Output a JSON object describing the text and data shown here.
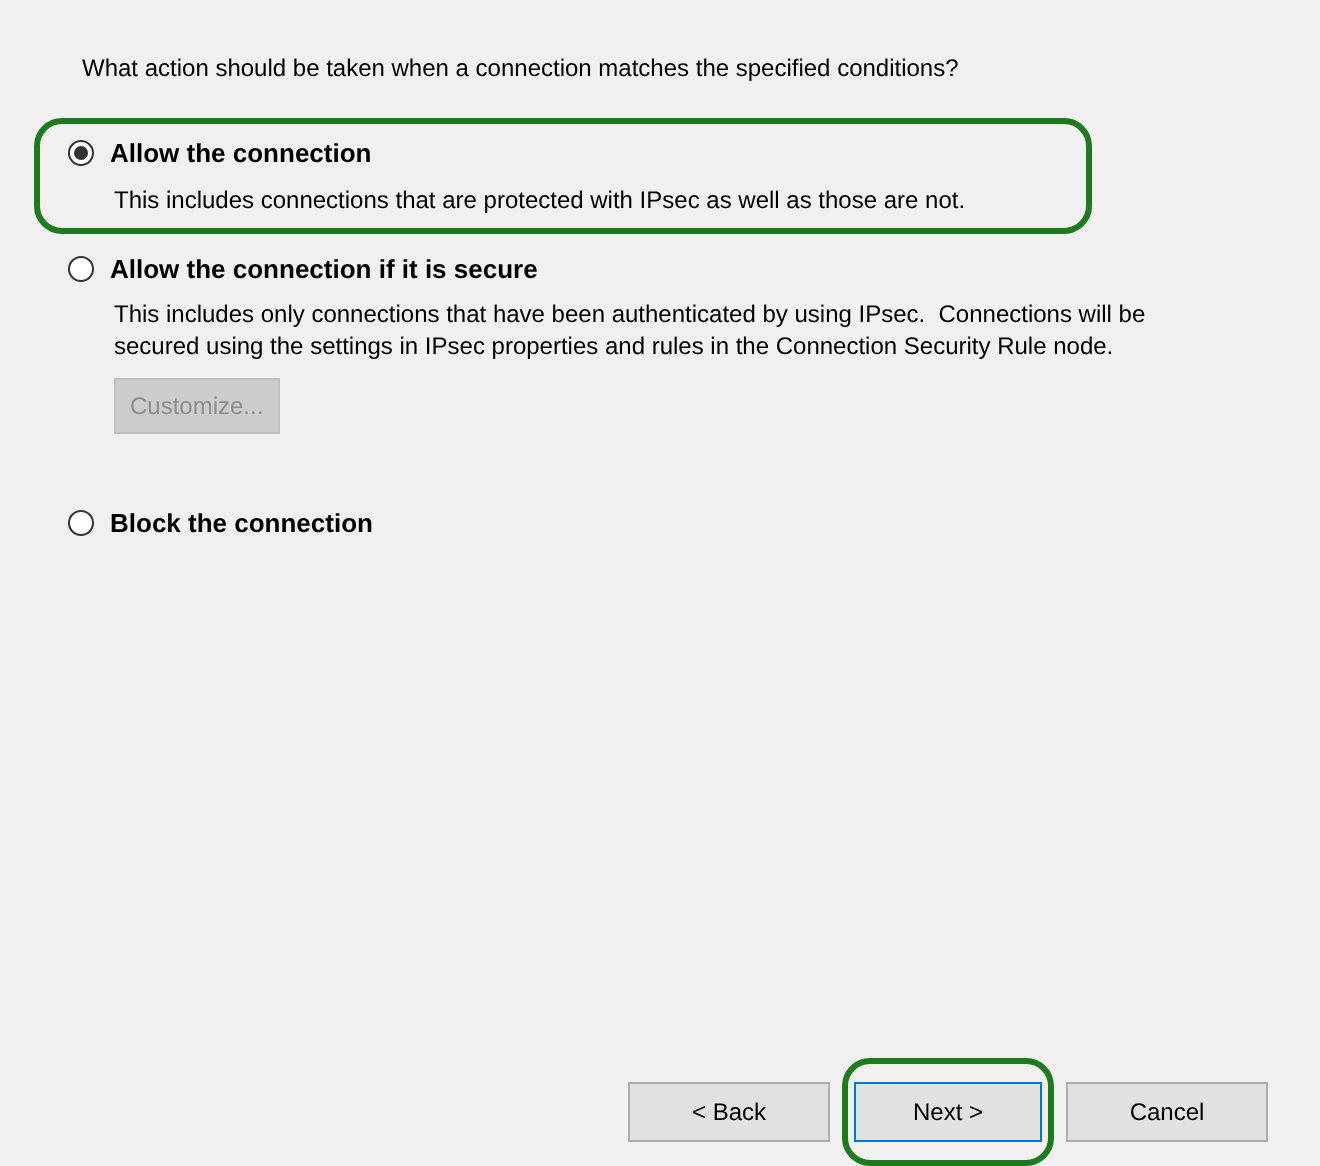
{
  "prompt": "What action should be taken when a connection matches the specified conditions?",
  "options": [
    {
      "label": "Allow the connection",
      "description": "This includes connections that are protected with IPsec as well as those are not.",
      "selected": true,
      "highlighted": true
    },
    {
      "label": "Allow the connection if it is secure",
      "description": "This includes only connections that have been authenticated by using IPsec.  Connections will be secured using the settings in IPsec properties and rules in the Connection Security Rule node.",
      "selected": false,
      "highlighted": false,
      "button": {
        "label": "Customize...",
        "disabled": true
      }
    },
    {
      "label": "Block the connection",
      "selected": false,
      "highlighted": false
    }
  ],
  "buttons": [
    {
      "label": "< Back",
      "focused": false,
      "highlighted": false
    },
    {
      "label": "Next >",
      "focused": true,
      "highlighted": true
    },
    {
      "label": "Cancel",
      "focused": false,
      "highlighted": false
    }
  ]
}
